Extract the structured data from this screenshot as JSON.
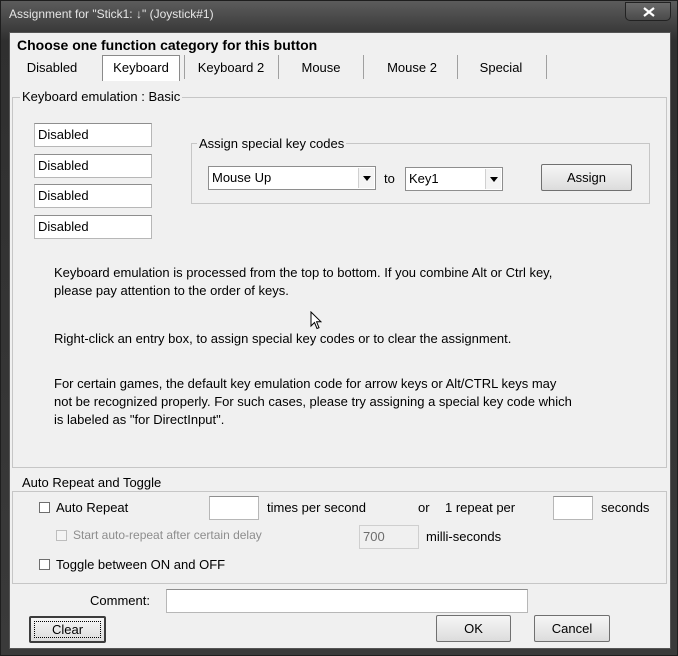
{
  "window": {
    "title": "Assignment for \"Stick1: ↓\" (Joystick#1)",
    "close_icon": "close-icon"
  },
  "dialog": {
    "heading": "Choose one function category for this button",
    "tabs": [
      {
        "label": "Disabled",
        "active": false
      },
      {
        "label": "Keyboard",
        "active": true
      },
      {
        "label": "Keyboard 2",
        "active": false
      },
      {
        "label": "Mouse",
        "active": false
      },
      {
        "label": "Mouse 2",
        "active": false
      },
      {
        "label": "Special",
        "active": false
      }
    ]
  },
  "keyboard": {
    "group_label": "Keyboard emulation : Basic",
    "entries": [
      "Disabled",
      "Disabled",
      "Disabled",
      "Disabled"
    ],
    "special": {
      "group_label": "Assign special key codes",
      "source_value": "Mouse Up",
      "to_label": "to",
      "target_value": "Key1",
      "assign_label": "Assign"
    },
    "info": [
      [
        "Keyboard emulation is processed from the top to bottom.  If you combine Alt or Ctrl key,",
        "please pay attention to the order of keys."
      ],
      [
        "Right-click an entry box, to assign special key codes or to clear the assignment."
      ],
      [
        "For certain games, the default key emulation code for arrow keys or Alt/CTRL keys may",
        "not be recognized properly.  For such cases, please try assigning a special key code which",
        "is labeled as \"for DirectInput\"."
      ]
    ]
  },
  "repeat": {
    "group_label": "Auto Repeat and Toggle",
    "auto_repeat": {
      "label": "Auto Repeat",
      "checked": false
    },
    "times_value": "",
    "times_label": "times per second",
    "or_label": "or",
    "one_repeat_label": "1 repeat per",
    "seconds_value": "",
    "seconds_label": "seconds",
    "delay": {
      "label": "Start auto-repeat after certain delay",
      "checked": false,
      "enabled": false
    },
    "delay_value": "700",
    "delay_unit": "milli-seconds",
    "toggle": {
      "label": "Toggle between ON and OFF",
      "checked": false
    }
  },
  "footer": {
    "comment_label": "Comment:",
    "comment_value": "",
    "clear_label": "Clear",
    "ok_label": "OK",
    "cancel_label": "Cancel"
  }
}
